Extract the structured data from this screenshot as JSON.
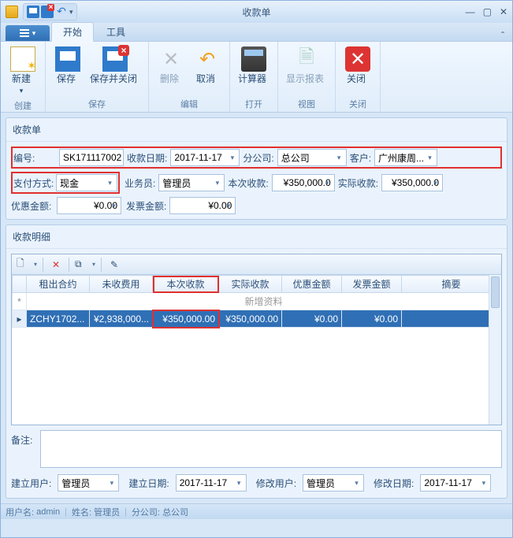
{
  "window": {
    "title": "收款单"
  },
  "tabs": {
    "start": "开始",
    "tools": "工具"
  },
  "ribbon": {
    "new": "新建",
    "save": "保存",
    "saveclose": "保存并关闭",
    "delete": "删除",
    "cancel": "取消",
    "calc": "计算器",
    "report": "显示报表",
    "close": "关闭",
    "g_create": "创建",
    "g_save": "保存",
    "g_edit": "编辑",
    "g_open": "打开",
    "g_view": "视图",
    "g_close": "关闭"
  },
  "form": {
    "header": "收款单",
    "code_lbl": "编号:",
    "code": "SK171117002",
    "date_lbl": "收款日期:",
    "date": "2017-11-17",
    "branch_lbl": "分公司:",
    "branch": "总公司",
    "customer_lbl": "客户:",
    "customer": "广州康周...",
    "paymethod_lbl": "支付方式:",
    "paymethod": "现金",
    "clerk_lbl": "业务员:",
    "clerk": "管理员",
    "thistime_lbl": "本次收款:",
    "thistime": "¥350,000.0",
    "actual_lbl": "实际收款:",
    "actual": "¥350,000.0",
    "discount_lbl": "优惠金额:",
    "discount": "¥0.00",
    "invoice_lbl": "发票金额:",
    "invoice": "¥0.00"
  },
  "detail": {
    "header": "收款明细",
    "cols": {
      "contract": "租出合约",
      "unpaid": "未收费用",
      "thistime": "本次收款",
      "actual": "实际收款",
      "discount": "优惠金额",
      "invoice": "发票金额",
      "remark": "摘要"
    },
    "newrow": "新增资料",
    "row": {
      "contract": "ZCHY1702...",
      "unpaid": "¥2,938,000...",
      "thistime": "¥350,000.00",
      "actual": "¥350,000.00",
      "discount": "¥0.00",
      "invoice": "¥0.00",
      "remark": ""
    }
  },
  "remark_lbl": "备注:",
  "footer": {
    "cuser_lbl": "建立用户:",
    "cuser": "管理员",
    "cdate_lbl": "建立日期:",
    "cdate": "2017-11-17",
    "muser_lbl": "修改用户:",
    "muser": "管理员",
    "mdate_lbl": "修改日期:",
    "mdate": "2017-11-17"
  },
  "status": {
    "user_lbl": "用户名:",
    "user": "admin",
    "name_lbl": "姓名:",
    "name": "管理员",
    "branch_lbl": "分公司:",
    "branch": "总公司"
  }
}
